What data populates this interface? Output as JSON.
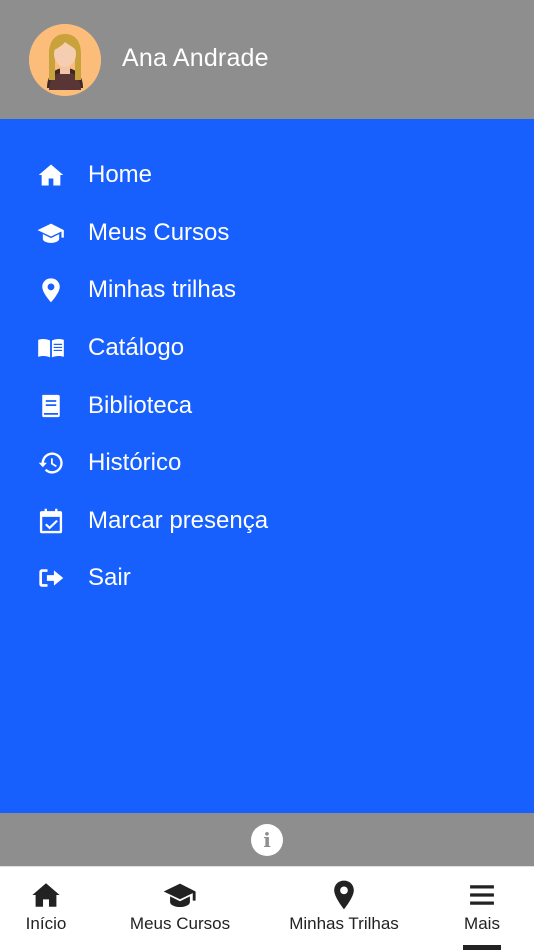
{
  "header": {
    "user_name": "Ana Andrade",
    "background_color": "#8e8e8e",
    "avatar_icon": "user-avatar-female"
  },
  "drawer": {
    "background_color": "#1760fe",
    "items": [
      {
        "label": "Home",
        "icon": "home-icon"
      },
      {
        "label": "Meus Cursos",
        "icon": "graduation-cap-icon"
      },
      {
        "label": "Minhas trilhas",
        "icon": "map-pin-icon"
      },
      {
        "label": "Catálogo",
        "icon": "open-book-icon"
      },
      {
        "label": "Biblioteca",
        "icon": "book-icon"
      },
      {
        "label": "Histórico",
        "icon": "history-icon"
      },
      {
        "label": "Marcar presença",
        "icon": "calendar-check-icon"
      },
      {
        "label": "Sair",
        "icon": "sign-out-icon"
      }
    ]
  },
  "info_bar": {
    "icon": "info-icon"
  },
  "bottom_nav": {
    "tabs": [
      {
        "label": "Início",
        "icon": "home-icon"
      },
      {
        "label": "Meus Cursos",
        "icon": "graduation-cap-icon"
      },
      {
        "label": "Minhas Trilhas",
        "icon": "map-pin-icon"
      },
      {
        "label": "Mais",
        "icon": "menu-icon"
      }
    ],
    "active_tab": "Mais"
  }
}
